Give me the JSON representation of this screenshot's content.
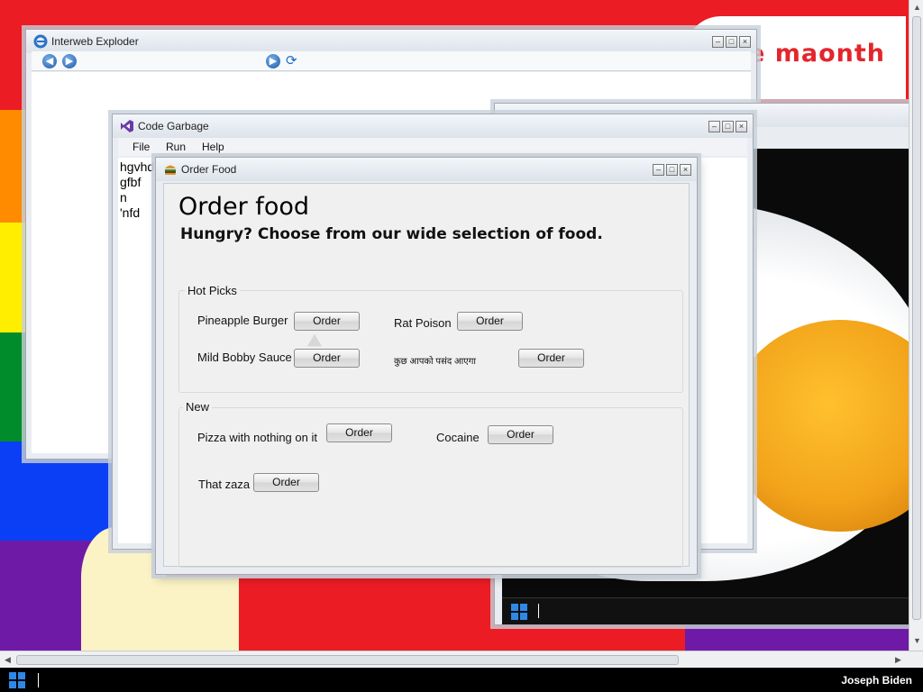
{
  "banner": {
    "text": "e maonth"
  },
  "ie_window": {
    "title": "Interweb Exploder",
    "icons": [
      "ie-logo-icon",
      "back-icon",
      "forward-icon",
      "go-icon",
      "refresh-icon"
    ]
  },
  "code_window": {
    "title": "Code Garbage",
    "menu": [
      "File",
      "Run",
      "Help"
    ],
    "lines": [
      "hgvhd",
      "gfbf",
      "n",
      "'nfd"
    ]
  },
  "order_window": {
    "title": "Order Food",
    "heading": "Order food",
    "subheading": "Hungry? Choose from our wide selection of food.",
    "groups": [
      {
        "label": "Hot Picks",
        "items": [
          {
            "name": "Pineapple Burger",
            "button": "Order"
          },
          {
            "name": "Rat Poison",
            "button": "Order"
          },
          {
            "name": "Mild Bobby Sauce",
            "button": "Order"
          },
          {
            "name": "कुछ आपको पसंद आएगा",
            "button": "Order"
          }
        ]
      },
      {
        "label": "New",
        "items": [
          {
            "name": "Pizza with nothing on it",
            "button": "Order"
          },
          {
            "name": "Cocaine",
            "button": "Order"
          },
          {
            "name": "That zaza",
            "button": "Order"
          }
        ]
      }
    ]
  },
  "window_controls": {
    "minimize": "–",
    "maximize": "□",
    "close": "×"
  },
  "taskbar": {
    "user": "Joseph Biden"
  },
  "colors": {
    "accent_blue": "#2f88e8",
    "banner_red": "#e3262c",
    "yolk": "#f2a31a"
  }
}
